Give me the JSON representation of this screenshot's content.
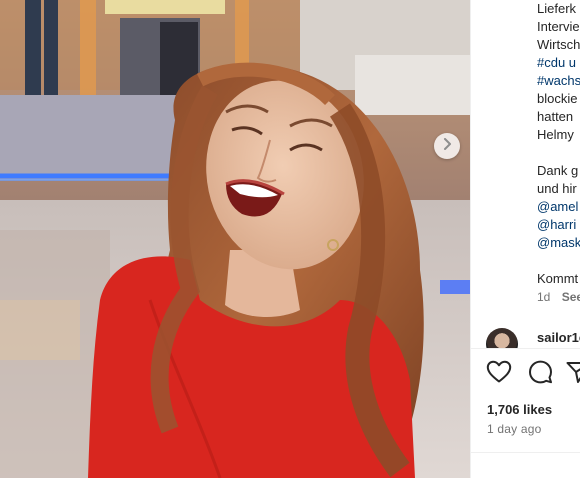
{
  "post": {
    "caption_lines": [
      {
        "text": "Lieferk",
        "tag": false
      },
      {
        "text": "Intervie",
        "tag": false
      },
      {
        "text": "Wirtsch",
        "tag": false
      },
      {
        "text": "#cdu u",
        "tag": true
      },
      {
        "text": "#wachs",
        "tag": true
      },
      {
        "text": "blockie",
        "tag": false
      },
      {
        "text": "hatten",
        "tag": false
      },
      {
        "text": "Helmy",
        "tag": false
      },
      {
        "text": "",
        "tag": false
      },
      {
        "text": "Dank g",
        "tag": false
      },
      {
        "text": "und hir",
        "tag": false
      },
      {
        "text": "@amel",
        "tag": true
      },
      {
        "text": "@harri",
        "tag": true
      },
      {
        "text": "@mask",
        "tag": true
      },
      {
        "text": "",
        "tag": false
      },
      {
        "text": "Kommt",
        "tag": false
      }
    ],
    "meta_time": "1d",
    "meta_see": "See",
    "comment_user": "sailor1e",
    "likes": "1,706 likes",
    "ago": "1 day ago"
  },
  "icons": {
    "next": "chevron-right-icon",
    "like": "heart-icon",
    "comment": "comment-icon",
    "share": "send-icon"
  },
  "colors": {
    "link": "#00376b",
    "text": "#262626",
    "muted": "#737373",
    "dress": "#d8261f"
  }
}
